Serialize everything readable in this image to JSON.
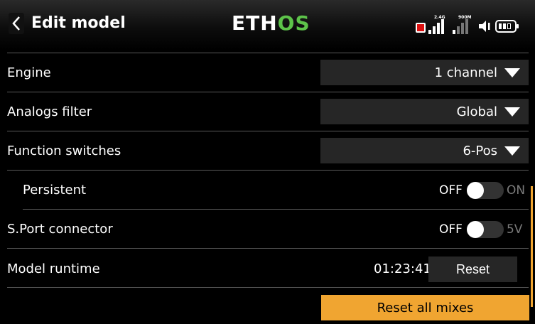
{
  "header": {
    "title": "Edit model",
    "logo_part1": "ETH",
    "logo_part2": "OS",
    "signal1_label": "2.4G",
    "signal2_label": "900M"
  },
  "rows": {
    "engine": {
      "label": "Engine",
      "value": "1 channel"
    },
    "analogs_filter": {
      "label": "Analogs filter",
      "value": "Global"
    },
    "function_switches": {
      "label": "Function switches",
      "value": "6-Pos"
    },
    "persistent": {
      "label": "Persistent",
      "off_label": "OFF",
      "on_label": "ON"
    },
    "sport_connector": {
      "label": "S.Port connector",
      "off_label": "OFF",
      "on_label": "5V"
    },
    "model_runtime": {
      "label": "Model runtime",
      "value": "01:23:41",
      "reset_label": "Reset"
    }
  },
  "actions": {
    "reset_all_label": "Reset all mixes"
  },
  "colors": {
    "accent": "#f0a531",
    "logo_green": "#5dc34a",
    "record": "#dd1111",
    "field_bg": "#262626"
  },
  "icons": [
    "back-chevron-icon",
    "record-icon",
    "signal-2g4-icon",
    "signal-900m-icon",
    "speaker-icon",
    "battery-icon"
  ]
}
